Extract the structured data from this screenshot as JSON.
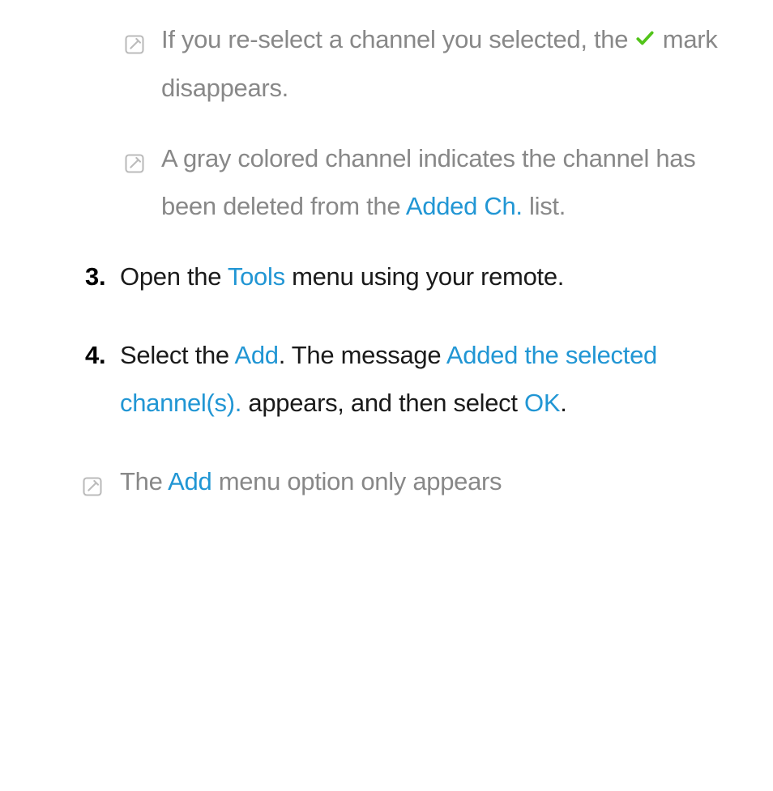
{
  "notes": {
    "n1": {
      "pre": "If you re-select a channel you selected, the ",
      "post": " mark disappears."
    },
    "n2": {
      "pre": "A gray colored channel indicates the channel has been deleted from the ",
      "link": "Added Ch.",
      "post": " list."
    }
  },
  "steps": {
    "s3": {
      "num": "3.",
      "t1": "Open the ",
      "tools": "Tools",
      "t2": " menu using your remote."
    },
    "s4": {
      "num": "4.",
      "t1": "Select the ",
      "add": "Add",
      "t2": ". The message ",
      "msg": "Added the selected channel(s).",
      "t3": " appears, and then select ",
      "ok": "OK",
      "t4": "."
    }
  },
  "footer": {
    "t1": "The ",
    "add": "Add",
    "t2": " menu option only appears"
  }
}
